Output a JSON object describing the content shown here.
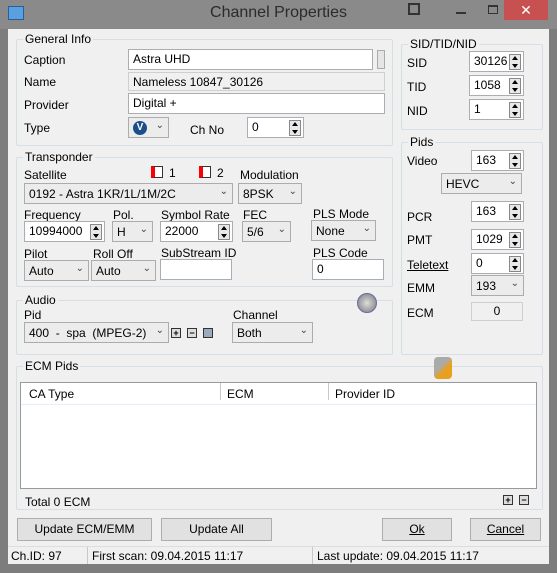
{
  "window": {
    "title": "Channel Properties",
    "close_color": "#c75050"
  },
  "general": {
    "label": "General Info",
    "caption_label": "Caption",
    "caption": "Astra UHD",
    "name_label": "Name",
    "name": "Nameless 10847_30126",
    "provider_label": "Provider",
    "provider": "Digital +",
    "type_label": "Type",
    "type_icon": "video-type-icon",
    "chno_label": "Ch No",
    "chno": "0"
  },
  "ids": {
    "label": "SID/TID/NID",
    "sid_label": "SID",
    "sid": "30126",
    "tid_label": "TID",
    "tid": "1058",
    "nid_label": "NID",
    "nid": "1"
  },
  "pids": {
    "label": "Pids",
    "video_label": "Video",
    "video": "163",
    "codec": "HEVC",
    "pcr_label": "PCR",
    "pcr": "163",
    "pmt_label": "PMT",
    "pmt": "1029",
    "teletext_label": "Teletext",
    "teletext": "0",
    "emm_label": "EMM",
    "emm": "193",
    "ecm_label": "ECM",
    "ecm": "0"
  },
  "transponder": {
    "label": "Transponder",
    "satellite_label": "Satellite",
    "sat1": "1",
    "sat2": "2",
    "satellite": "0192 - Astra 1KR/1L/1M/2C",
    "modulation_label": "Modulation",
    "modulation": "8PSK",
    "frequency_label": "Frequency",
    "frequency": "10994000",
    "pol_label": "Pol.",
    "pol": "H",
    "sr_label": "Symbol Rate",
    "sr": "22000",
    "fec_label": "FEC",
    "fec": "5/6",
    "pls_mode_label": "PLS Mode",
    "pls_mode": "None",
    "pilot_label": "Pilot",
    "pilot": "Auto",
    "rolloff_label": "Roll Off",
    "rolloff": "Auto",
    "substream_label": "SubStream ID",
    "substream": "",
    "pls_code_label": "PLS Code",
    "pls_code": "0"
  },
  "audio": {
    "label": "Audio",
    "pid_label": "Pid",
    "pid": "400  -  spa  (MPEG-2)",
    "channel_label": "Channel",
    "channel": "Both"
  },
  "ecm": {
    "label": "ECM Pids",
    "columns": [
      "CA Type",
      "ECM",
      "Provider ID"
    ],
    "total": "Total 0 ECM"
  },
  "buttons": {
    "update_ecm": "Update ECM/EMM",
    "update_all": "Update All",
    "ok": "Ok",
    "cancel": "Cancel"
  },
  "status": {
    "chid": "Ch.ID: 97",
    "first_scan": "First scan: 09.04.2015 11:17",
    "last_update": "Last update: 09.04.2015 11:17"
  }
}
